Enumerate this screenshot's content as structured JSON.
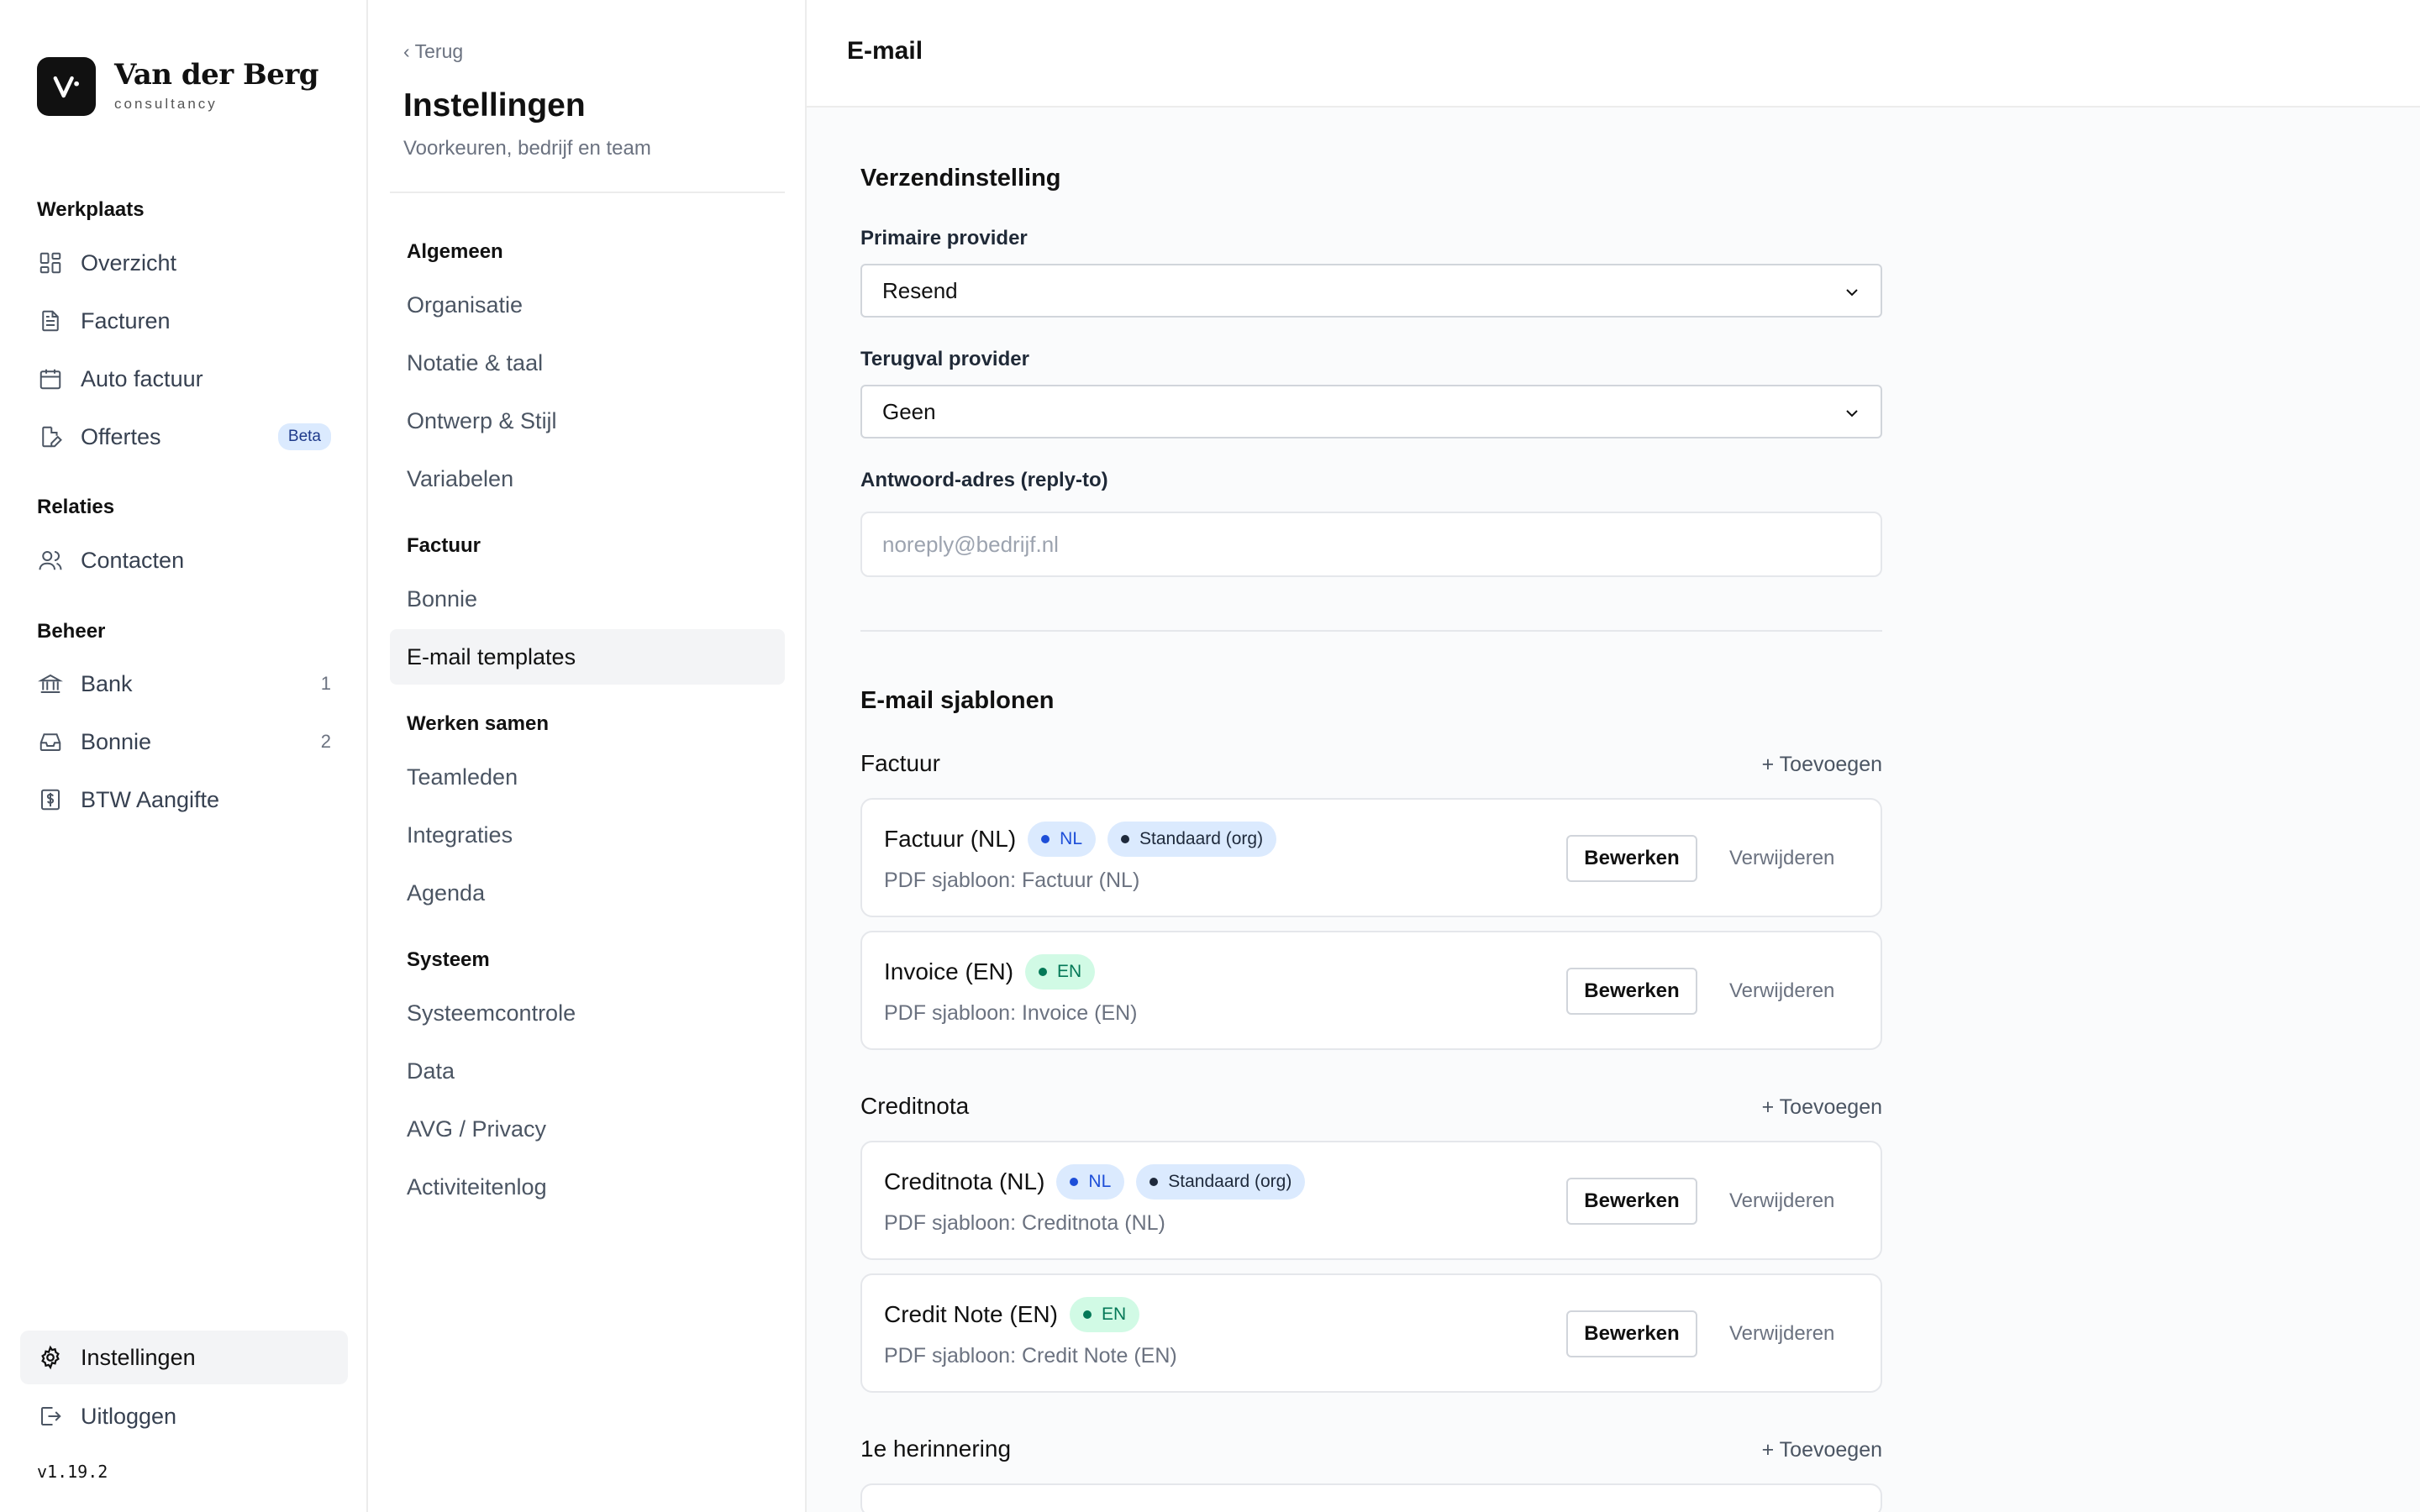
{
  "brand": {
    "name": "Van der Berg",
    "sub": "consultancy"
  },
  "sidebar": {
    "sections": [
      {
        "label": "Werkplaats",
        "items": [
          {
            "label": "Overzicht",
            "icon": "grid-icon"
          },
          {
            "label": "Facturen",
            "icon": "document-icon"
          },
          {
            "label": "Auto factuur",
            "icon": "calendar-icon"
          },
          {
            "label": "Offertes",
            "icon": "document-edit-icon",
            "badge": "Beta"
          }
        ]
      },
      {
        "label": "Relaties",
        "items": [
          {
            "label": "Contacten",
            "icon": "users-icon"
          }
        ]
      },
      {
        "label": "Beheer",
        "items": [
          {
            "label": "Bank",
            "icon": "bank-icon",
            "count": "1"
          },
          {
            "label": "Bonnie",
            "icon": "inbox-icon",
            "count": "2"
          },
          {
            "label": "BTW Aangifte",
            "icon": "receipt-dollar-icon"
          }
        ]
      }
    ],
    "bottom": {
      "settings": "Instellingen",
      "logout": "Uitloggen"
    },
    "version": "v1.19.2"
  },
  "subnav": {
    "back": "‹ Terug",
    "title": "Instellingen",
    "description": "Voorkeuren, bedrijf en team",
    "groups": [
      {
        "label": "Algemeen",
        "items": [
          "Organisatie",
          "Notatie & taal",
          "Ontwerp & Stijl",
          "Variabelen"
        ]
      },
      {
        "label": "Factuur",
        "items": [
          "Bonnie",
          "E-mail templates"
        ]
      },
      {
        "label": "Werken samen",
        "items": [
          "Teamleden",
          "Integraties",
          "Agenda"
        ]
      },
      {
        "label": "Systeem",
        "items": [
          "Systeemcontrole",
          "Data",
          "AVG / Privacy",
          "Activiteitenlog"
        ]
      }
    ],
    "active": "E-mail templates"
  },
  "main": {
    "title": "E-mail",
    "sending": {
      "title": "Verzendinstelling",
      "primary_label": "Primaire provider",
      "primary_value": "Resend",
      "fallback_label": "Terugval provider",
      "fallback_value": "Geen",
      "reply_label": "Antwoord-adres (reply-to)",
      "reply_placeholder": "noreply@bedrijf.nl"
    },
    "templates": {
      "title": "E-mail sjablonen",
      "add_label": "+ Toevoegen",
      "edit_label": "Bewerken",
      "delete_label": "Verwijderen",
      "categories": [
        {
          "label": "Factuur",
          "items": [
            {
              "name": "Factuur (NL)",
              "lang": "NL",
              "default": "Standaard (org)",
              "pdf": "PDF sjabloon: Factuur (NL)"
            },
            {
              "name": "Invoice (EN)",
              "lang": "EN",
              "pdf": "PDF sjabloon: Invoice (EN)"
            }
          ]
        },
        {
          "label": "Creditnota",
          "items": [
            {
              "name": "Creditnota (NL)",
              "lang": "NL",
              "default": "Standaard (org)",
              "pdf": "PDF sjabloon: Creditnota (NL)"
            },
            {
              "name": "Credit Note (EN)",
              "lang": "EN",
              "pdf": "PDF sjabloon: Credit Note (EN)"
            }
          ]
        },
        {
          "label": "1e herinnering",
          "items": []
        }
      ]
    }
  },
  "colors": {
    "accent_blue": "#1d4ed8",
    "accent_green": "#047857",
    "badge_blue_bg": "#dbeafe",
    "badge_green_bg": "#d1fae5"
  }
}
